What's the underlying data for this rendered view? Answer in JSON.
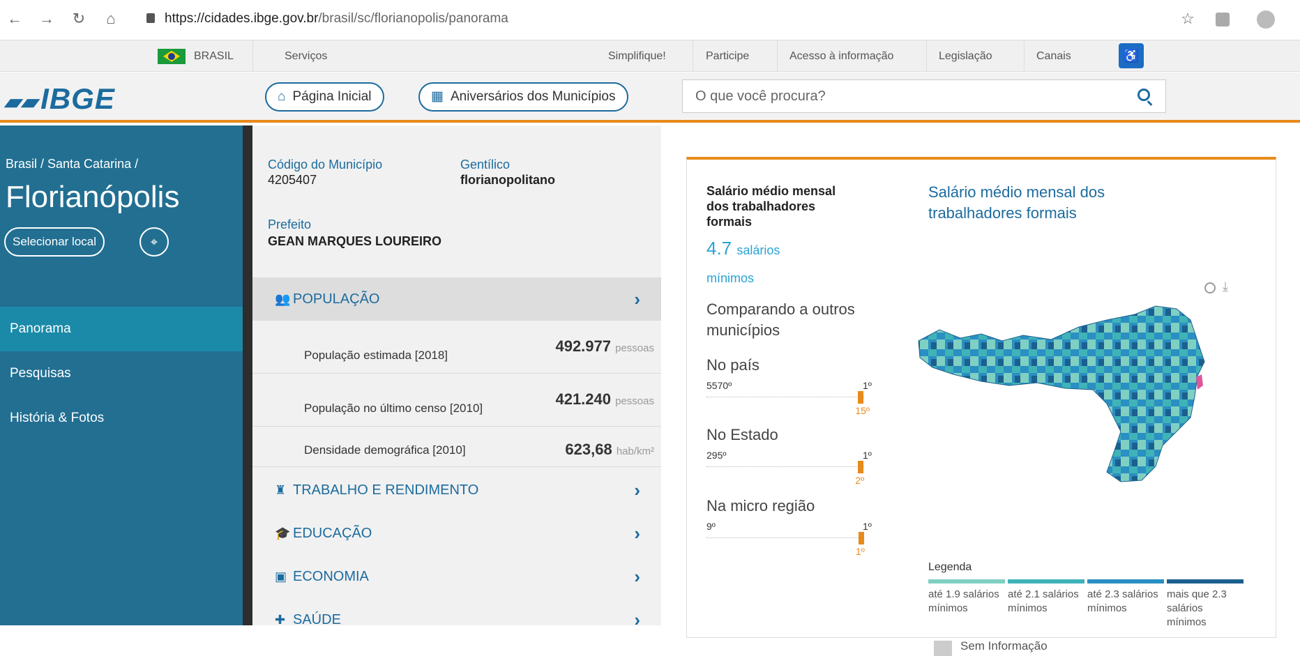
{
  "browser": {
    "url_host": "https://cidades.ibge.gov.br",
    "url_path": "/brasil/sc/florianopolis/panorama"
  },
  "govbar": {
    "brasil": "BRASIL",
    "servicos": "Serviços",
    "links": [
      "Simplifique!",
      "Participe",
      "Acesso à informação",
      "Legislação",
      "Canais"
    ]
  },
  "header": {
    "logo": "IBGE",
    "home": "Página Inicial",
    "anniversaries": "Aniversários dos Municípios",
    "search_placeholder": "O que você procura?"
  },
  "sidebar": {
    "breadcrumb": "Brasil / Santa Catarina /",
    "city": "Florianópolis",
    "select_label": "Selecionar local",
    "items": [
      "Panorama",
      "Pesquisas",
      "História & Fotos"
    ]
  },
  "info": {
    "code_label": "Código do Município",
    "code_value": "4205407",
    "gentilic_label": "Gentílico",
    "gentilic_value": "florianopolitano",
    "mayor_label": "Prefeito",
    "mayor_value": "GEAN MARQUES LOUREIRO"
  },
  "sections": {
    "populacao": "POPULAÇÃO",
    "trabalho": "TRABALHO E RENDIMENTO",
    "educacao": "EDUCAÇÃO",
    "economia": "ECONOMIA",
    "saude": "SAÚDE"
  },
  "population_rows": [
    {
      "label": "População estimada [2018]",
      "value": "492.977",
      "unit": "pessoas"
    },
    {
      "label": "População no último censo [2010]",
      "value": "421.240",
      "unit": "pessoas"
    },
    {
      "label": "Densidade demográfica [2010]",
      "value": "623,68",
      "unit": "hab/km²"
    }
  ],
  "card": {
    "title": "Salário médio mensal dos trabalhadores formais",
    "value": "4.7",
    "unit_line1": "salários",
    "unit_line2": "mínimos",
    "compare": "Comparando a outros municípios",
    "country_label": "No país",
    "country_min": "5570º",
    "country_max": "1º",
    "country_pos": "15º",
    "country_fraction": 0.997,
    "state_label": "No Estado",
    "state_min": "295º",
    "state_max": "1º",
    "state_pos": "2º",
    "state_fraction": 0.997,
    "micro_label": "Na micro região",
    "micro_min": "9º",
    "micro_max": "1º",
    "micro_pos": "1º",
    "micro_fraction": 1.0,
    "map_title": "Salário médio mensal dos trabalhadores formais",
    "legend_title": "Legenda",
    "legend": [
      {
        "label": "até 1.9 salários mínimos",
        "color": "#7fd0c2"
      },
      {
        "label": "até 2.1 salários mínimos",
        "color": "#3fb3b8"
      },
      {
        "label": "até 2.3 salários mínimos",
        "color": "#2a8fc2"
      },
      {
        "label": "mais que 2.3 salários mínimos",
        "color": "#1c5f8e"
      }
    ],
    "no_info": "Sem Informação"
  }
}
